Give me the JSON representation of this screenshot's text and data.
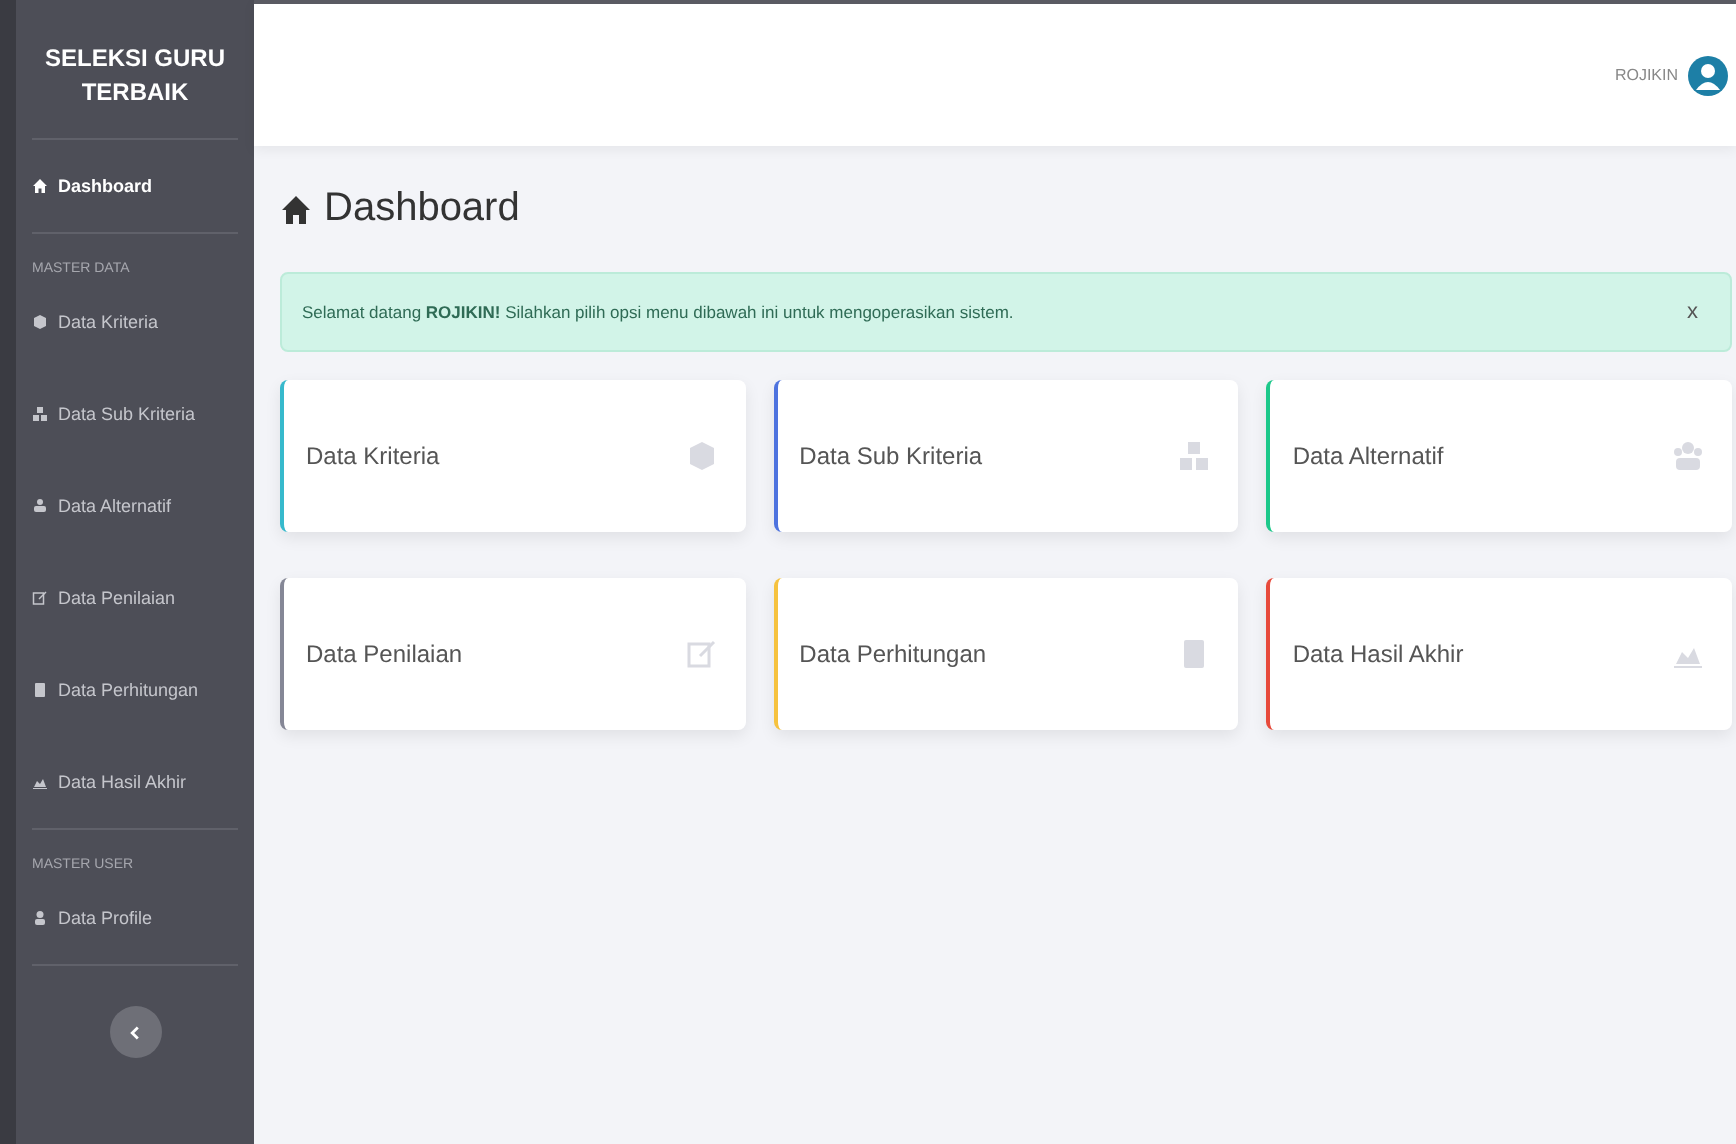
{
  "sidebar": {
    "brand": "SELEKSI GURU TERBAIK",
    "items": [
      {
        "kind": "link",
        "label": "Dashboard",
        "selected": true
      },
      {
        "kind": "heading",
        "label": "MASTER DATA"
      },
      {
        "kind": "link",
        "label": "Data Kriteria",
        "selected": false
      },
      {
        "kind": "link",
        "label": "Data Sub Kriteria",
        "selected": false
      },
      {
        "kind": "link",
        "label": "Data Alternatif",
        "selected": false
      },
      {
        "kind": "link",
        "label": "Data Penilaian",
        "selected": false
      },
      {
        "kind": "link",
        "label": "Data Perhitungan",
        "selected": false
      },
      {
        "kind": "link",
        "label": "Data Hasil Akhir",
        "selected": false
      },
      {
        "kind": "heading",
        "label": "MASTER USER"
      },
      {
        "kind": "link",
        "label": "Data Profile",
        "selected": false
      }
    ]
  },
  "topbar": {
    "user": "ROJIKIN"
  },
  "page_title": "Dashboard",
  "alert": {
    "text": "Selamat datang **ROJIKIN!** Silahkan pilih opsi menu dibawah ini untuk mengoperasikan sistem.",
    "close": "x"
  },
  "cards": [
    {
      "label": "Data Kriteria",
      "color": "#36b9cc"
    },
    {
      "label": "Data Sub Kriteria",
      "color": "#4e73df"
    },
    {
      "label": "Data Alternatif",
      "color": "#1cc88a"
    },
    {
      "label": "Data Penilaian",
      "color": "#858796"
    },
    {
      "label": "Data Perhitungan",
      "color": "#f6c23e"
    },
    {
      "label": "Data Hasil Akhir",
      "color": "#e74a3b"
    }
  ]
}
